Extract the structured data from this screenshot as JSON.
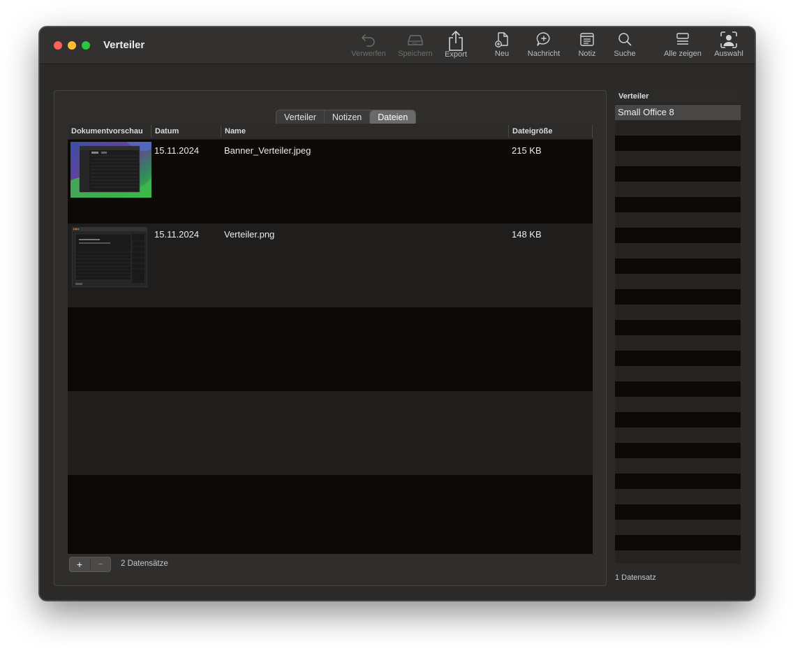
{
  "window": {
    "title": "Verteiler"
  },
  "toolbar": {
    "items": [
      {
        "label": "Verwerfen",
        "icon": "undo-icon",
        "enabled": false
      },
      {
        "label": "Speichern",
        "icon": "drive-icon",
        "enabled": false
      },
      {
        "label": "Export",
        "icon": "share-icon",
        "enabled": true
      },
      {
        "label": "Neu",
        "icon": "new-document-icon",
        "enabled": true
      },
      {
        "label": "Nachricht",
        "icon": "message-plus-icon",
        "enabled": true
      },
      {
        "label": "Notiz",
        "icon": "note-icon",
        "enabled": true
      },
      {
        "label": "Suche",
        "icon": "search-icon",
        "enabled": true
      },
      {
        "label": "Alle zeigen",
        "icon": "list-icon",
        "enabled": true
      },
      {
        "label": "Auswahl",
        "icon": "person-select-icon",
        "enabled": true
      }
    ]
  },
  "tabs": {
    "items": [
      "Verteiler",
      "Notizen",
      "Dateien"
    ],
    "active": "Dateien"
  },
  "files_table": {
    "columns": [
      "Dokumentvorschau",
      "Datum",
      "Name",
      "Dateigröße"
    ],
    "rows": [
      {
        "date": "15.11.2024",
        "name": "Banner_Verteiler.jpeg",
        "size": "215 KB",
        "preview": "banner-thumbnail"
      },
      {
        "date": "15.11.2024",
        "name": "Verteiler.png",
        "size": "148 KB",
        "preview": "screenshot-thumbnail"
      }
    ],
    "add_label": "+",
    "remove_label": "−",
    "count": "2 Datensätze"
  },
  "side_list": {
    "header": "Verteiler",
    "items": [
      "Small Office 8"
    ],
    "selected": "Small Office 8",
    "count": "1 Datensatz"
  }
}
